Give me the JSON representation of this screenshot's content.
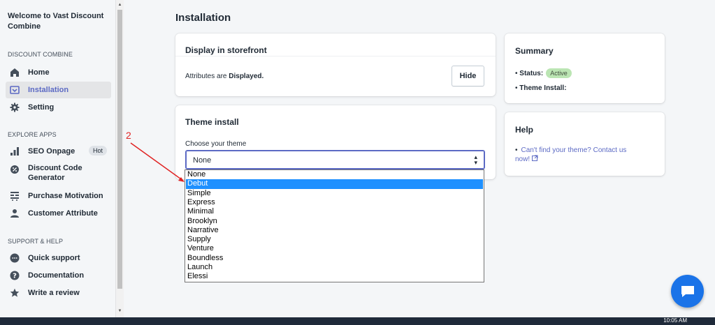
{
  "sidebar": {
    "title": "Welcome to Vast Discount Combine",
    "sections": {
      "discount": "DISCOUNT COMBINE",
      "explore": "EXPLORE APPS",
      "support": "SUPPORT & HELP"
    },
    "items": {
      "home": "Home",
      "installation": "Installation",
      "setting": "Setting",
      "seo": "SEO Onpage",
      "seo_badge": "Hot",
      "discount_code": "Discount Code Generator",
      "purchase": "Purchase Motivation",
      "customer": "Customer Attribute",
      "quick": "Quick support",
      "docs": "Documentation",
      "review": "Write a review"
    }
  },
  "main": {
    "page_title": "Installation",
    "storefront": {
      "title": "Display in storefront",
      "text_prefix": "Attributes are ",
      "text_bold": "Displayed.",
      "hide_label": "Hide"
    },
    "theme": {
      "title": "Theme install",
      "choose_label": "Choose your theme",
      "selected": "None",
      "options": [
        "None",
        "Debut",
        "Simple",
        "Express",
        "Minimal",
        "Brooklyn",
        "Narrative",
        "Supply",
        "Venture",
        "Boundless",
        "Launch",
        "Elessi"
      ],
      "highlighted": "Debut"
    },
    "summary": {
      "title": "Summary",
      "status_label": "Status:",
      "status_value": "Active",
      "theme_label": "Theme Install:"
    },
    "help": {
      "title": "Help",
      "link": "Can't find your theme? Contact us now!"
    }
  },
  "annotation": "2",
  "taskbar": {
    "clock": "10:05 AM"
  },
  "colors": {
    "accent": "#5c6ac4",
    "highlight": "#1e90ff",
    "chat": "#1a73e8"
  }
}
